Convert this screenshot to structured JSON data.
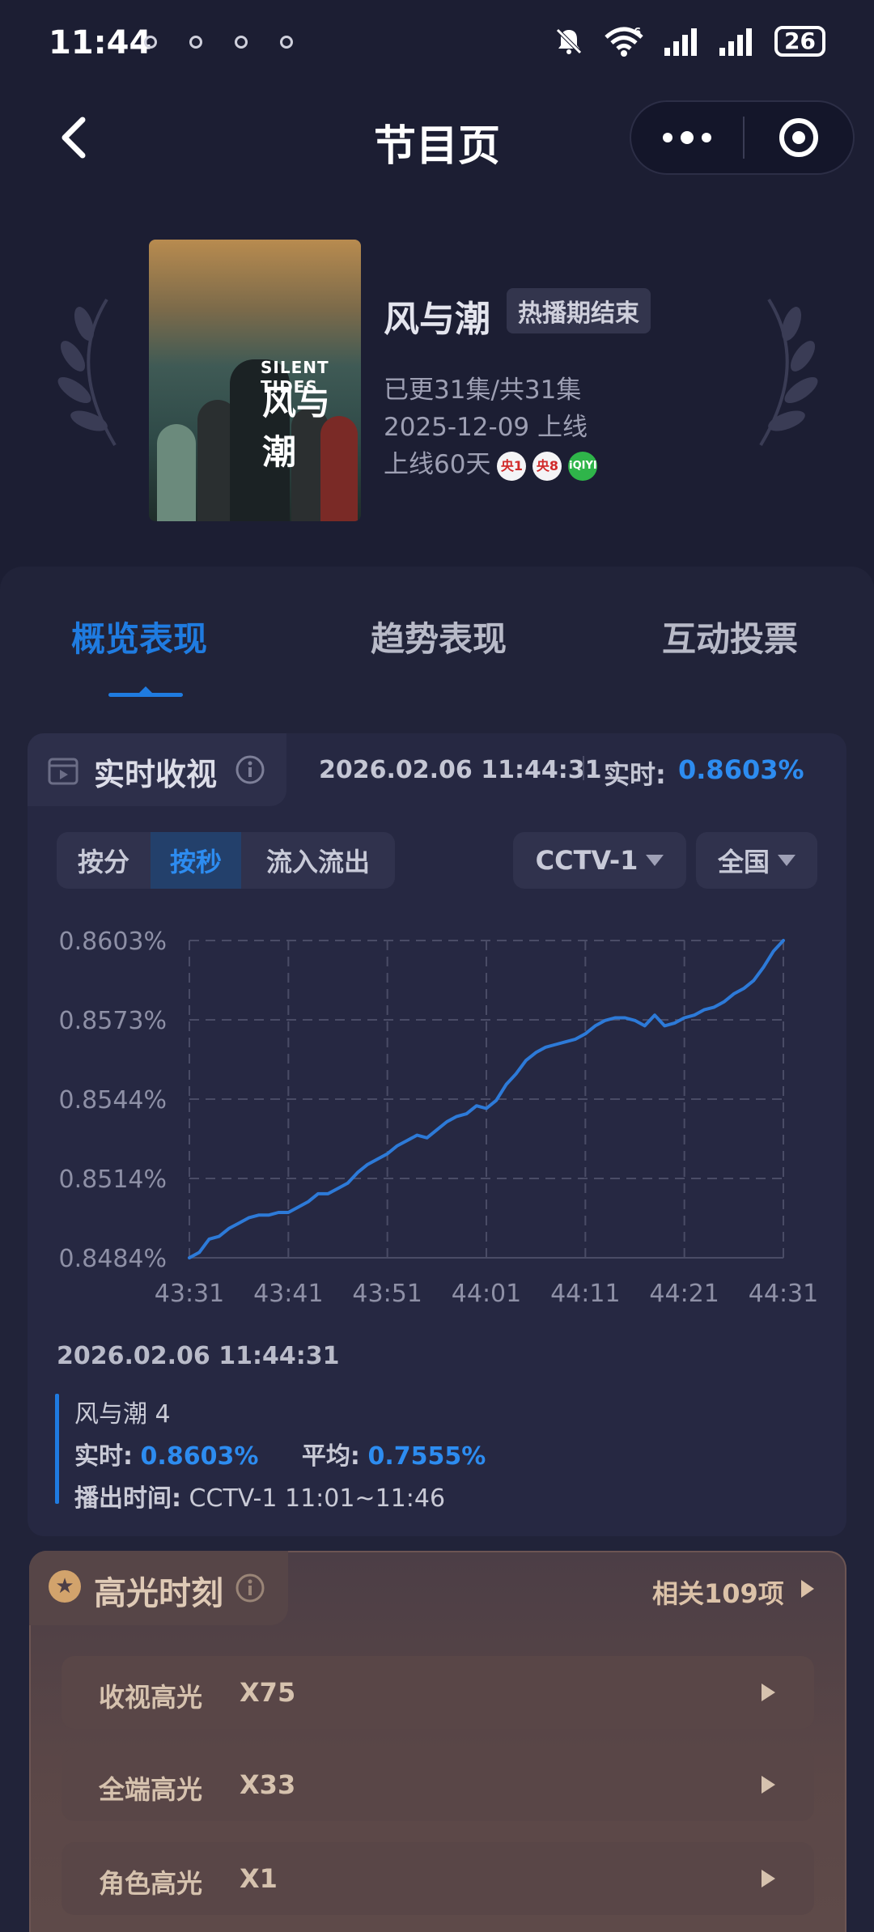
{
  "status_bar": {
    "time": "11:44",
    "network_badge": "6",
    "battery": "26"
  },
  "nav": {
    "title": "节目页"
  },
  "show": {
    "poster_en": "SILENT TIDES",
    "poster_cn": "风与潮",
    "title": "风与潮",
    "badge": "热播期结束",
    "episodes": "已更31集/共31集",
    "launch": "2025-12-09 上线",
    "online_days": "上线60天",
    "channels": [
      {
        "label": "央1",
        "icon": "cctv1-icon"
      },
      {
        "label": "央8",
        "icon": "cctv8-icon"
      },
      {
        "label": "iQIYI",
        "icon": "iqiyi-icon"
      }
    ]
  },
  "tabs": [
    "概览表现",
    "趋势表现",
    "互动投票"
  ],
  "realtime": {
    "label": "实时收视",
    "timestamp": "2026.02.06 11:44:31",
    "value_label": "实时:",
    "value": "0.8603%"
  },
  "controls": {
    "segments": [
      "按分",
      "按秒",
      "流入流出"
    ],
    "channel": "CCTV-1",
    "region": "全国"
  },
  "chart_data": {
    "type": "line",
    "y_ticks": [
      "0.8603%",
      "0.8573%",
      "0.8544%",
      "0.8514%",
      "0.8484%"
    ],
    "x_ticks": [
      "43:31",
      "43:41",
      "43:51",
      "44:01",
      "44:11",
      "44:21",
      "44:31"
    ],
    "ylim": [
      0.8484,
      0.8603
    ],
    "grid": true,
    "series": [
      {
        "color": "#2d7ad8",
        "points": [
          [
            "43:31",
            0.8484
          ],
          [
            "43:32",
            0.8486
          ],
          [
            "43:33",
            0.8491
          ],
          [
            "43:34",
            0.8492
          ],
          [
            "43:35",
            0.8495
          ],
          [
            "43:36",
            0.8497
          ],
          [
            "43:37",
            0.8499
          ],
          [
            "43:38",
            0.85
          ],
          [
            "43:39",
            0.85
          ],
          [
            "43:40",
            0.8501
          ],
          [
            "43:41",
            0.8501
          ],
          [
            "43:42",
            0.8503
          ],
          [
            "43:43",
            0.8505
          ],
          [
            "43:44",
            0.8508
          ],
          [
            "43:45",
            0.8508
          ],
          [
            "43:46",
            0.851
          ],
          [
            "43:47",
            0.8512
          ],
          [
            "43:48",
            0.8516
          ],
          [
            "43:49",
            0.8519
          ],
          [
            "43:50",
            0.8521
          ],
          [
            "43:51",
            0.8523
          ],
          [
            "43:52",
            0.8526
          ],
          [
            "43:53",
            0.8528
          ],
          [
            "43:54",
            0.853
          ],
          [
            "43:55",
            0.8529
          ],
          [
            "43:56",
            0.8532
          ],
          [
            "43:57",
            0.8535
          ],
          [
            "43:58",
            0.8537
          ],
          [
            "43:59",
            0.8538
          ],
          [
            "44:00",
            0.8541
          ],
          [
            "44:01",
            0.854
          ],
          [
            "44:02",
            0.8543
          ],
          [
            "44:03",
            0.8549
          ],
          [
            "44:04",
            0.8553
          ],
          [
            "44:05",
            0.8558
          ],
          [
            "44:06",
            0.8561
          ],
          [
            "44:07",
            0.8563
          ],
          [
            "44:08",
            0.8564
          ],
          [
            "44:09",
            0.8565
          ],
          [
            "44:10",
            0.8566
          ],
          [
            "44:11",
            0.8568
          ],
          [
            "44:12",
            0.8571
          ],
          [
            "44:13",
            0.8573
          ],
          [
            "44:14",
            0.8574
          ],
          [
            "44:15",
            0.8574
          ],
          [
            "44:16",
            0.8573
          ],
          [
            "44:17",
            0.8571
          ],
          [
            "44:18",
            0.8575
          ],
          [
            "44:19",
            0.8571
          ],
          [
            "44:20",
            0.8572
          ],
          [
            "44:21",
            0.8574
          ],
          [
            "44:22",
            0.8575
          ],
          [
            "44:23",
            0.8577
          ],
          [
            "44:24",
            0.8578
          ],
          [
            "44:25",
            0.858
          ],
          [
            "44:26",
            0.8583
          ],
          [
            "44:27",
            0.8585
          ],
          [
            "44:28",
            0.8588
          ],
          [
            "44:29",
            0.8593
          ],
          [
            "44:30",
            0.8599
          ],
          [
            "44:31",
            0.8603
          ]
        ]
      }
    ]
  },
  "tooltip": {
    "timestamp": "2026.02.06 11:44:31",
    "program": "风与潮 4",
    "realtime_label": "实时:",
    "realtime_value": "0.8603%",
    "avg_label": "平均:",
    "avg_value": "0.7555%",
    "airtime_label": "播出时间:",
    "airtime_value": "CCTV-1 11:01~11:46"
  },
  "highlights": {
    "title": "高光时刻",
    "more": "相关109项",
    "items": [
      {
        "name": "收视高光",
        "count": "X75"
      },
      {
        "name": "全端高光",
        "count": "X33"
      },
      {
        "name": "角色高光",
        "count": "X1"
      }
    ]
  }
}
